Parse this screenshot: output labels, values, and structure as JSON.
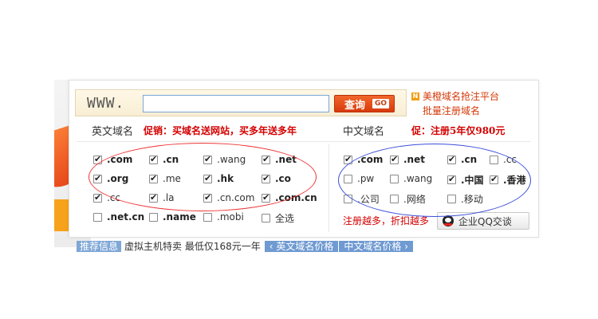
{
  "search": {
    "prefix": "WWW.",
    "input_value": "",
    "button_label": "查询",
    "button_badge": "GO"
  },
  "promo_links": {
    "line1": "美橙域名抢注平台",
    "line2": "批量注册域名"
  },
  "english_section": {
    "title": "英文域名",
    "promo": "促销：买域名送网站，买多年送多年",
    "domains": [
      {
        "label": ".com",
        "checked": true,
        "bold": true
      },
      {
        "label": ".cn",
        "checked": true,
        "bold": true
      },
      {
        "label": ".wang",
        "checked": true,
        "bold": false
      },
      {
        "label": ".net",
        "checked": true,
        "bold": true
      },
      {
        "label": ".org",
        "checked": true,
        "bold": true
      },
      {
        "label": ".me",
        "checked": true,
        "bold": false
      },
      {
        "label": ".hk",
        "checked": true,
        "bold": true
      },
      {
        "label": ".co",
        "checked": true,
        "bold": true
      },
      {
        "label": ".cc",
        "checked": true,
        "bold": false
      },
      {
        "label": ".la",
        "checked": true,
        "bold": false
      },
      {
        "label": ".cn.com",
        "checked": true,
        "bold": false
      },
      {
        "label": ".com.cn",
        "checked": true,
        "bold": true
      },
      {
        "label": ".net.cn",
        "checked": false,
        "bold": true
      },
      {
        "label": ".name",
        "checked": false,
        "bold": true
      },
      {
        "label": ".mobi",
        "checked": false,
        "bold": false
      },
      {
        "label": "全选",
        "checked": false,
        "bold": false
      }
    ]
  },
  "chinese_section": {
    "title": "中文域名",
    "promo": "促：注册5年仅980元",
    "domains": [
      {
        "label": ".com",
        "checked": true,
        "bold": true
      },
      {
        "label": ".net",
        "checked": true,
        "bold": true
      },
      {
        "label": ".cn",
        "checked": true,
        "bold": true
      },
      {
        "label": ".cc",
        "checked": false,
        "bold": false
      },
      {
        "label": ".pw",
        "checked": false,
        "bold": false
      },
      {
        "label": ".wang",
        "checked": false,
        "bold": false
      },
      {
        "label": ".中国",
        "checked": true,
        "bold": true
      },
      {
        "label": ".香港",
        "checked": true,
        "bold": true
      },
      {
        "label": ".公司",
        "checked": false,
        "bold": false
      },
      {
        "label": ".网络",
        "checked": false,
        "bold": false
      },
      {
        "label": ".移动",
        "checked": false,
        "bold": false
      }
    ],
    "register_more": "注册越多，折扣越多",
    "qq_button": "企业QQ交谈"
  },
  "bottom_bar": {
    "tag": "推荐信息",
    "text": "虚拟主机特卖 最低仅168元一年",
    "tab_english": "‹ 英文域名价格",
    "tab_chinese": "中文域名价格 ›"
  },
  "colors": {
    "accent_orange": "#d73a0c",
    "promo_red": "#d40000",
    "annotation_red": "#e33333",
    "annotation_blue": "#3b4fd8"
  }
}
